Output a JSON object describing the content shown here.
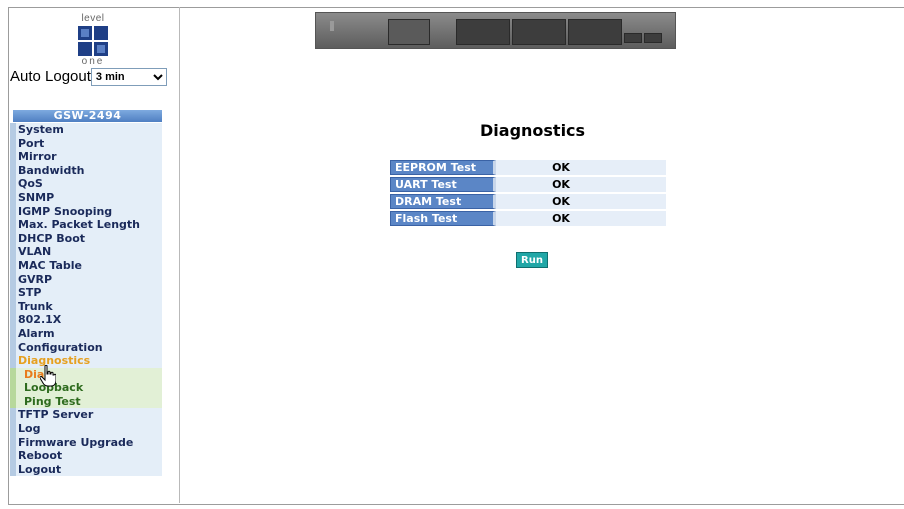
{
  "header": {
    "logo": {
      "top_text": "level",
      "bottom_text": "one"
    },
    "auto_logout": {
      "label": "Auto Logout",
      "selected": "3 min"
    }
  },
  "sidebar": {
    "device_name": "GSW-2494",
    "items": [
      {
        "label": "System"
      },
      {
        "label": "Port"
      },
      {
        "label": "Mirror"
      },
      {
        "label": "Bandwidth"
      },
      {
        "label": "QoS"
      },
      {
        "label": "SNMP"
      },
      {
        "label": "IGMP Snooping"
      },
      {
        "label": "Max. Packet Length"
      },
      {
        "label": "DHCP Boot"
      },
      {
        "label": "VLAN"
      },
      {
        "label": "MAC Table"
      },
      {
        "label": "GVRP"
      },
      {
        "label": "STP"
      },
      {
        "label": "Trunk"
      },
      {
        "label": "802.1X"
      },
      {
        "label": "Alarm"
      },
      {
        "label": "Configuration"
      },
      {
        "label": "Diagnostics"
      },
      {
        "label": "Diag"
      },
      {
        "label": "Loopback"
      },
      {
        "label": "Ping Test"
      },
      {
        "label": "TFTP Server"
      },
      {
        "label": "Log"
      },
      {
        "label": "Firmware Upgrade"
      },
      {
        "label": "Reboot"
      },
      {
        "label": "Logout"
      }
    ]
  },
  "main": {
    "title": "Diagnostics",
    "tests": [
      {
        "name": "EEPROM Test",
        "result": "OK"
      },
      {
        "name": "UART Test",
        "result": "OK"
      },
      {
        "name": "DRAM Test",
        "result": "OK"
      },
      {
        "name": "Flash Test",
        "result": "OK"
      }
    ],
    "run_label": "Run"
  },
  "colors": {
    "menu_bg": "#e4eef8",
    "menu_active": "#e6a020",
    "label_bg": "#5b86c6",
    "run_button": "#21a7a7"
  }
}
